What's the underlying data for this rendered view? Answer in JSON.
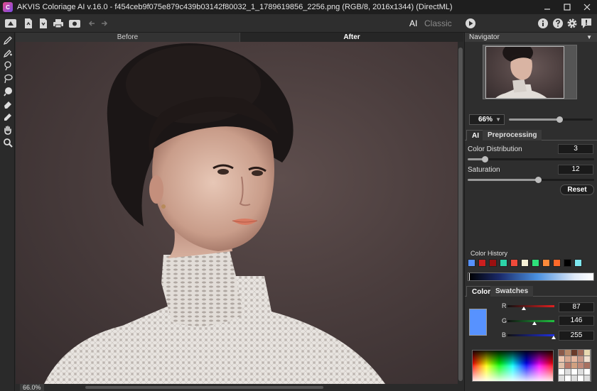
{
  "window": {
    "title": "AKVIS Coloriage AI v.16.0 - f454ceb9f075e879c439b03142f80032_1_1789619856_2256.png (RGB/8, 2016x1344) (DirectML)",
    "logo_text": "C"
  },
  "toolbar": {
    "mode_ai": "AI",
    "mode_classic": "Classic"
  },
  "view_tabs": {
    "before": "Before",
    "after": "After"
  },
  "status": {
    "zoom": "66.0%"
  },
  "navigator": {
    "header": "Navigator",
    "zoom_value": "66%",
    "zoom_slider_fraction": 0.6
  },
  "ai_panel": {
    "tab_ai": "AI",
    "tab_preprocessing": "Preprocessing",
    "color_distribution_label": "Color Distribution",
    "color_distribution_value": "3",
    "saturation_label": "Saturation",
    "saturation_value": "12",
    "reset_label": "Reset"
  },
  "color_history": {
    "label": "Color History",
    "swatches": [
      "#5792ff",
      "#cc1f1f",
      "#9a1010",
      "#2dd4a8",
      "#f04a3a",
      "#f7f1d7",
      "#2ee07a",
      "#ff8a3a",
      "#ff6a2a",
      "#000000",
      "#7ee8f0"
    ]
  },
  "color_panel": {
    "tab_color": "Color",
    "tab_swatches": "Swatches",
    "current_color": "#5792ff",
    "r_label": "R",
    "g_label": "G",
    "b_label": "B",
    "r_value": "87",
    "g_value": "146",
    "b_value": "255"
  },
  "colors": {
    "accent": "#5792ff",
    "background": "#2b2b2b",
    "panel": "#2e2e2e"
  }
}
